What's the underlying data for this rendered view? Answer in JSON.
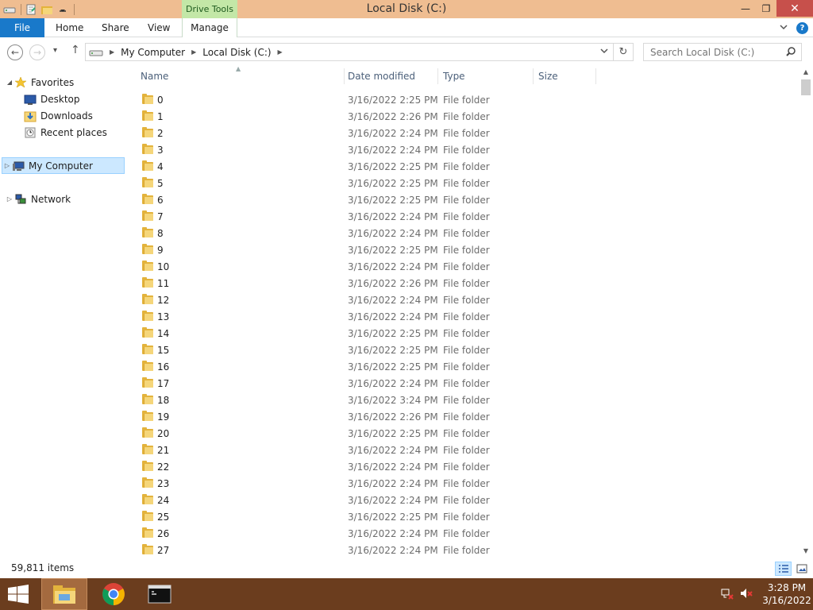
{
  "titlebar": {
    "contextual_tab": "Drive Tools",
    "title": "Local Disk (C:)",
    "minimize": "—",
    "restore": "❐",
    "close": "✕"
  },
  "ribbon": {
    "file": "File",
    "home": "Home",
    "share": "Share",
    "view": "View",
    "manage": "Manage",
    "expand_icon": "chevron-down-icon",
    "help": "?"
  },
  "navbar": {
    "back": "←",
    "forward": "→",
    "recent": "▾",
    "up": "↑",
    "breadcrumb": [
      "My Computer",
      "Local Disk (C:)"
    ],
    "refresh": "↻",
    "search_placeholder": "Search Local Disk (C:)"
  },
  "navpane": {
    "favorites": "Favorites",
    "desktop": "Desktop",
    "downloads": "Downloads",
    "recent_places": "Recent places",
    "my_computer": "My Computer",
    "network": "Network"
  },
  "columns": {
    "name": "Name",
    "date_modified": "Date modified",
    "type": "Type",
    "size": "Size"
  },
  "files": [
    {
      "name": "0",
      "date": "3/16/2022 2:25 PM",
      "type": "File folder"
    },
    {
      "name": "1",
      "date": "3/16/2022 2:26 PM",
      "type": "File folder"
    },
    {
      "name": "2",
      "date": "3/16/2022 2:24 PM",
      "type": "File folder"
    },
    {
      "name": "3",
      "date": "3/16/2022 2:24 PM",
      "type": "File folder"
    },
    {
      "name": "4",
      "date": "3/16/2022 2:25 PM",
      "type": "File folder"
    },
    {
      "name": "5",
      "date": "3/16/2022 2:25 PM",
      "type": "File folder"
    },
    {
      "name": "6",
      "date": "3/16/2022 2:25 PM",
      "type": "File folder"
    },
    {
      "name": "7",
      "date": "3/16/2022 2:24 PM",
      "type": "File folder"
    },
    {
      "name": "8",
      "date": "3/16/2022 2:24 PM",
      "type": "File folder"
    },
    {
      "name": "9",
      "date": "3/16/2022 2:25 PM",
      "type": "File folder"
    },
    {
      "name": "10",
      "date": "3/16/2022 2:24 PM",
      "type": "File folder"
    },
    {
      "name": "11",
      "date": "3/16/2022 2:26 PM",
      "type": "File folder"
    },
    {
      "name": "12",
      "date": "3/16/2022 2:24 PM",
      "type": "File folder"
    },
    {
      "name": "13",
      "date": "3/16/2022 2:24 PM",
      "type": "File folder"
    },
    {
      "name": "14",
      "date": "3/16/2022 2:25 PM",
      "type": "File folder"
    },
    {
      "name": "15",
      "date": "3/16/2022 2:25 PM",
      "type": "File folder"
    },
    {
      "name": "16",
      "date": "3/16/2022 2:25 PM",
      "type": "File folder"
    },
    {
      "name": "17",
      "date": "3/16/2022 2:24 PM",
      "type": "File folder"
    },
    {
      "name": "18",
      "date": "3/16/2022 3:24 PM",
      "type": "File folder"
    },
    {
      "name": "19",
      "date": "3/16/2022 2:26 PM",
      "type": "File folder"
    },
    {
      "name": "20",
      "date": "3/16/2022 2:25 PM",
      "type": "File folder"
    },
    {
      "name": "21",
      "date": "3/16/2022 2:24 PM",
      "type": "File folder"
    },
    {
      "name": "22",
      "date": "3/16/2022 2:24 PM",
      "type": "File folder"
    },
    {
      "name": "23",
      "date": "3/16/2022 2:24 PM",
      "type": "File folder"
    },
    {
      "name": "24",
      "date": "3/16/2022 2:24 PM",
      "type": "File folder"
    },
    {
      "name": "25",
      "date": "3/16/2022 2:25 PM",
      "type": "File folder"
    },
    {
      "name": "26",
      "date": "3/16/2022 2:24 PM",
      "type": "File folder"
    },
    {
      "name": "27",
      "date": "3/16/2022 2:24 PM",
      "type": "File folder"
    }
  ],
  "status": {
    "item_count": "59,811 items"
  },
  "taskbar": {
    "items": [
      "file-explorer-icon",
      "chrome-icon",
      "command-prompt-icon"
    ],
    "time": "3:28 PM",
    "date": "3/16/2022"
  },
  "colors": {
    "titlebar": "#efbd91",
    "contextual_tab": "#c3e7a7",
    "file_tab": "#1979ca",
    "close_button": "#c7504b",
    "taskbar": "#6b3d1e",
    "selection": "#cce8ff"
  }
}
